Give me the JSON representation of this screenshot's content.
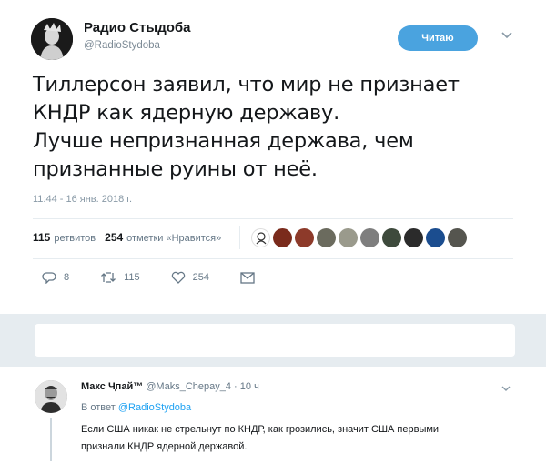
{
  "author": {
    "name": "Радио Стыдоба",
    "handle": "@RadioStydoba"
  },
  "follow_button": "Читаю",
  "tweet": {
    "lines": [
      "Тиллерсон заявил, что мир не признает",
      "КНДР как ядерную державу.",
      "Лучше непризнанная держава, чем",
      "признанные руины от неё."
    ],
    "timestamp": "11:44 - 16 янв. 2018 г."
  },
  "stats": {
    "retweets_count": "115",
    "retweets_label": "ретвитов",
    "likes_count": "254",
    "likes_label": "отметки «Нравится»"
  },
  "actions": {
    "replies": "8",
    "retweets": "115",
    "likes": "254"
  },
  "reply": {
    "name": "Макс Ч̹пай™",
    "handle": "@Maks_Chepay_4",
    "time": "10 ч",
    "in_reply_prefix": "В ответ",
    "in_reply_mention": "@RadioStydoba",
    "lines": [
      "Если США никак не стрельнут по КНДР, как грозились, значит США первыми",
      "признали КНДР ядерной державой."
    ]
  },
  "colors": {
    "accent": "#1da1f2",
    "follow_bg": "#4aa3df",
    "muted": "#657786",
    "band": "#e6ecf0"
  },
  "icons": [
    "chevron-down-icon",
    "reply-icon",
    "retweet-icon",
    "heart-icon",
    "direct-message-icon"
  ]
}
